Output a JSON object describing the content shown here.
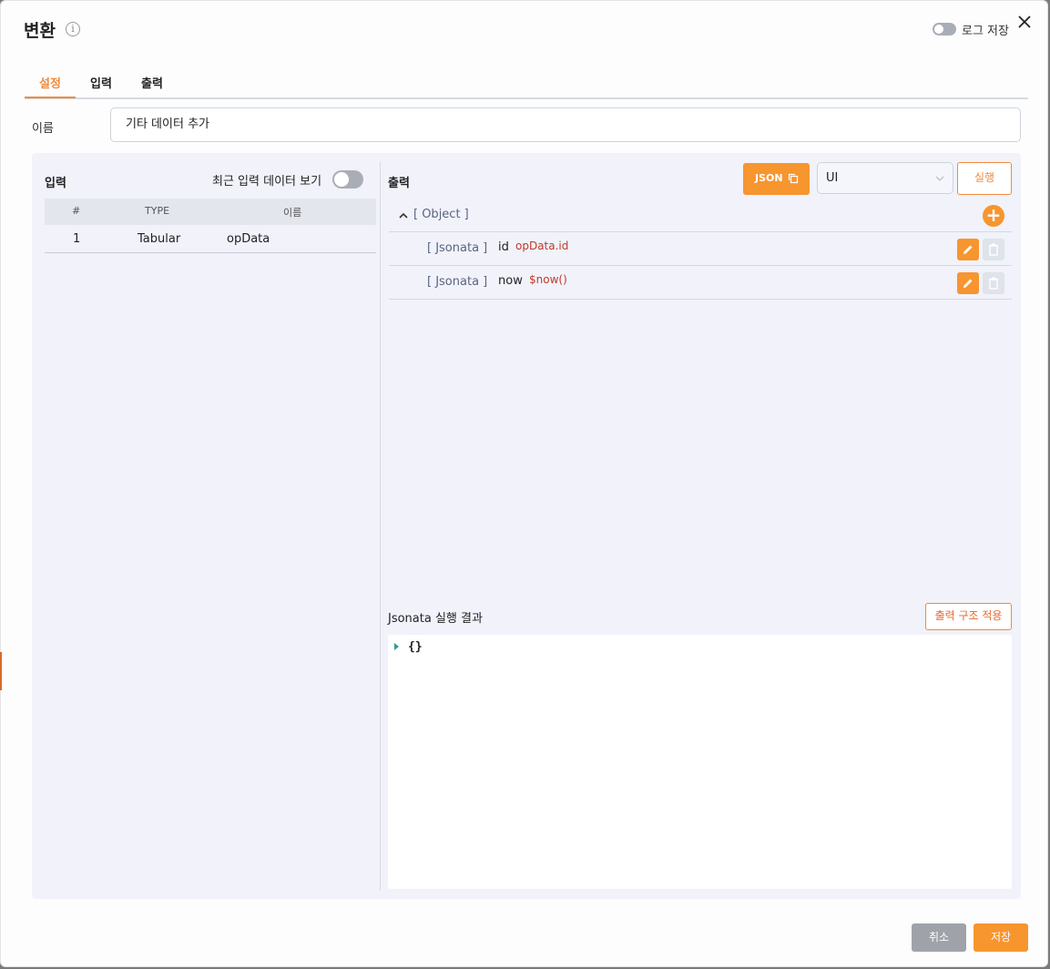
{
  "header": {
    "title": "변환",
    "info_icon": "info-icon",
    "log_save_label": "로그 저장",
    "log_save_enabled": false,
    "close_icon": "close-icon"
  },
  "tabs": [
    {
      "label": "설정",
      "active": true
    },
    {
      "label": "입력",
      "active": false
    },
    {
      "label": "출력",
      "active": false
    }
  ],
  "name_field": {
    "label": "이름",
    "value": "기타 데이터 추가"
  },
  "input_panel": {
    "title": "입력",
    "recent_toggle_label": "최근 입력 데이터 보기",
    "recent_toggle_enabled": false,
    "columns": [
      "#",
      "TYPE",
      "이름"
    ],
    "rows": [
      {
        "index": "1",
        "type": "Tabular",
        "name": "opData"
      }
    ]
  },
  "output_panel": {
    "title": "출력",
    "json_button_label": "JSON",
    "mode_select_value": "UI",
    "run_button_label": "실행",
    "object_label": "[ Object ]",
    "fields": [
      {
        "type": "[ Jsonata ]",
        "name": "id",
        "expression": "opData.id"
      },
      {
        "type": "[ Jsonata ]",
        "name": "now",
        "expression": "$now()"
      }
    ],
    "result_title": "Jsonata 실행 결과",
    "apply_button_label": "출력 구조 적용",
    "result_value": "{}"
  },
  "footer": {
    "cancel_label": "취소",
    "save_label": "저장"
  },
  "colors": {
    "accent": "#f7952f",
    "panel_bg": "#f1f2fa",
    "expression": "#c0392b"
  }
}
